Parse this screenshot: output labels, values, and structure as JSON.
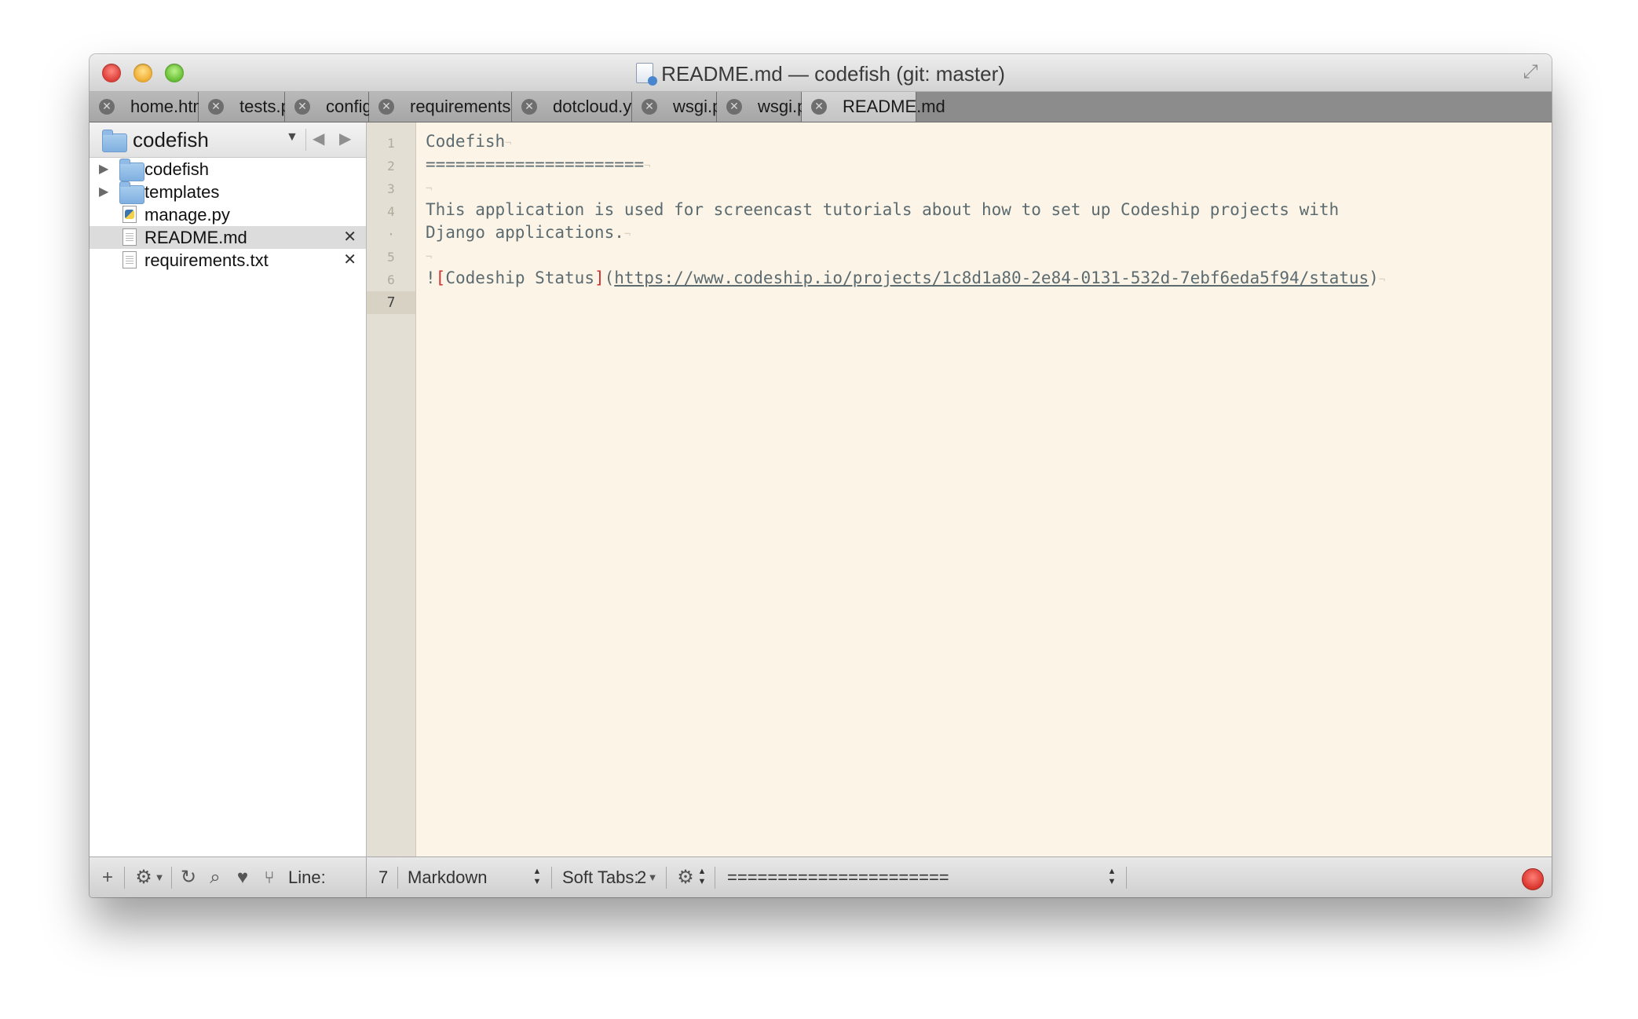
{
  "window": {
    "title": "README.md — codefish (git: master)"
  },
  "tabs": [
    {
      "label": "home.html",
      "active": false
    },
    {
      "label": "tests.py",
      "active": false
    },
    {
      "label": "config",
      "active": false
    },
    {
      "label": "requirements.txt",
      "active": false
    },
    {
      "label": "dotcloud.yml",
      "active": false
    },
    {
      "label": "wsgi.py",
      "active": false
    },
    {
      "label": "wsgi.py",
      "active": false
    },
    {
      "label": "README.md",
      "active": true
    }
  ],
  "sidebar": {
    "project_name": "codefish",
    "items": [
      {
        "label": "codefish",
        "type": "folder"
      },
      {
        "label": "templates",
        "type": "folder"
      },
      {
        "label": "manage.py",
        "type": "python-file"
      },
      {
        "label": "README.md",
        "type": "text-file",
        "selected": true,
        "open": true
      },
      {
        "label": "requirements.txt",
        "type": "text-file",
        "selected": false,
        "open": true
      }
    ]
  },
  "editor": {
    "gutter": [
      "1",
      "2",
      "3",
      "4",
      "·",
      "5",
      "6",
      "7"
    ],
    "current_line_index": 7,
    "lines": {
      "l1": "Codefish",
      "l2": "======================",
      "l4a": "This application is used for screencast tutorials about how to set up Codeship projects with",
      "l4b": "Django applications.",
      "l6_bang": "!",
      "l6_open": "[",
      "l6_text": "Codeship Status",
      "l6_close": "]",
      "l6_paren_open": "(",
      "l6_url": "https://www.codeship.io/projects/1c8d1a80-2e84-0131-532d-7ebf6eda5f94/status",
      "l6_paren_close": ")"
    },
    "eol_marker": "¬"
  },
  "statusbar": {
    "line_label": "Line:",
    "line_value": "7",
    "language": "Markdown",
    "soft_tabs_label": "Soft Tabs:",
    "soft_tabs_value": "2",
    "symbol": "======================"
  },
  "icons": {
    "add": "plus-icon",
    "settings": "gear-icon",
    "refresh": "refresh-icon",
    "search": "search-icon",
    "favorites": "heart-icon",
    "scm": "branch-icon"
  }
}
